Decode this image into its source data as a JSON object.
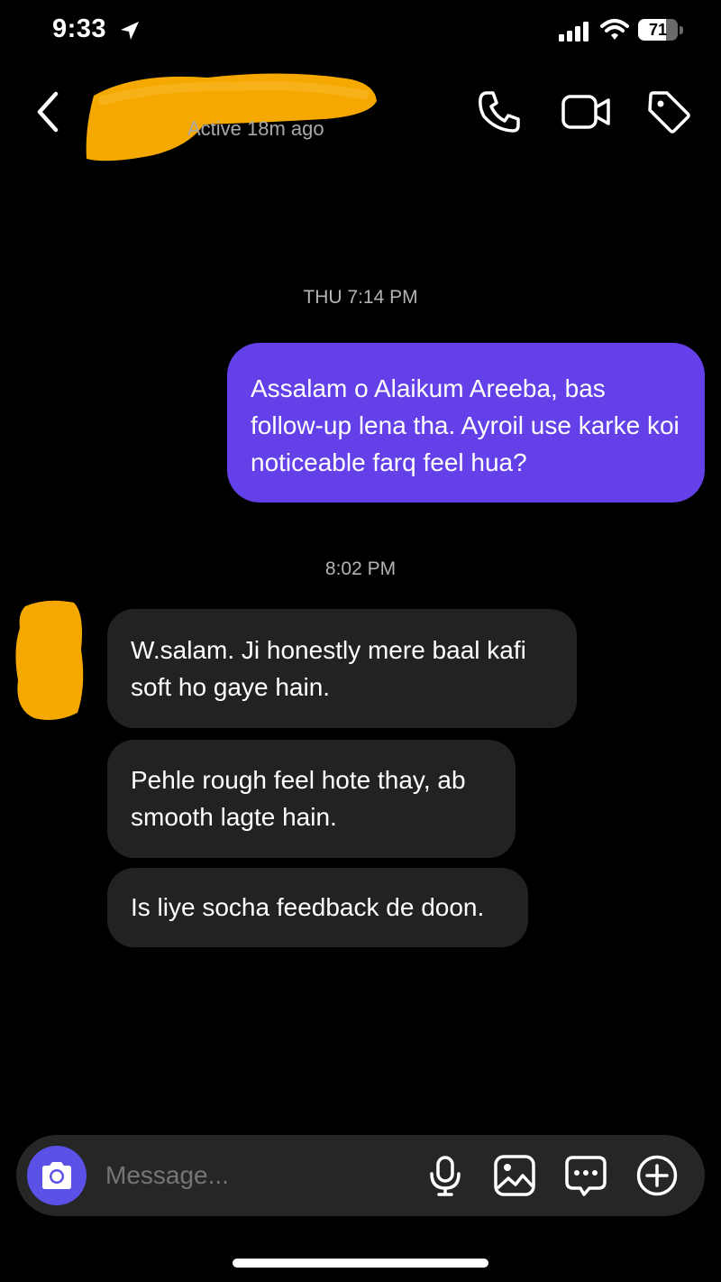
{
  "status_bar": {
    "time": "9:33",
    "battery_percent": "71",
    "battery_level": 0.71,
    "icons": [
      "location-arrow-icon",
      "signal-icon",
      "wifi-icon",
      "battery-icon"
    ]
  },
  "header": {
    "contact_name_redacted": true,
    "active_status": "Active 18m ago",
    "icons": [
      "back-chevron-icon",
      "phone-icon",
      "video-camera-icon",
      "tag-icon"
    ]
  },
  "conversation": {
    "stamp_1": "THU 7:14 PM",
    "sent_message": "Assalam o Alaikum Areeba, bas follow-up lena tha. Ayroil use karke koi noticeable farq feel hua?",
    "stamp_2": "8:02 PM",
    "received": [
      "W.salam. Ji honestly mere baal kafi soft ho gaye hain.",
      "Pehle rough feel hote thay, ab smooth lagte hain.",
      "Is liye socha feedback de doon."
    ]
  },
  "composer": {
    "placeholder": "Message...",
    "icons": [
      "camera-icon",
      "microphone-icon",
      "gallery-icon",
      "sticker-chat-icon",
      "plus-icon"
    ]
  },
  "colors": {
    "background": "#000000",
    "sent_bubble": "#6440e8",
    "received_bubble": "#222222",
    "camera_button": "#5b51e6",
    "redaction": "#f5a800"
  }
}
